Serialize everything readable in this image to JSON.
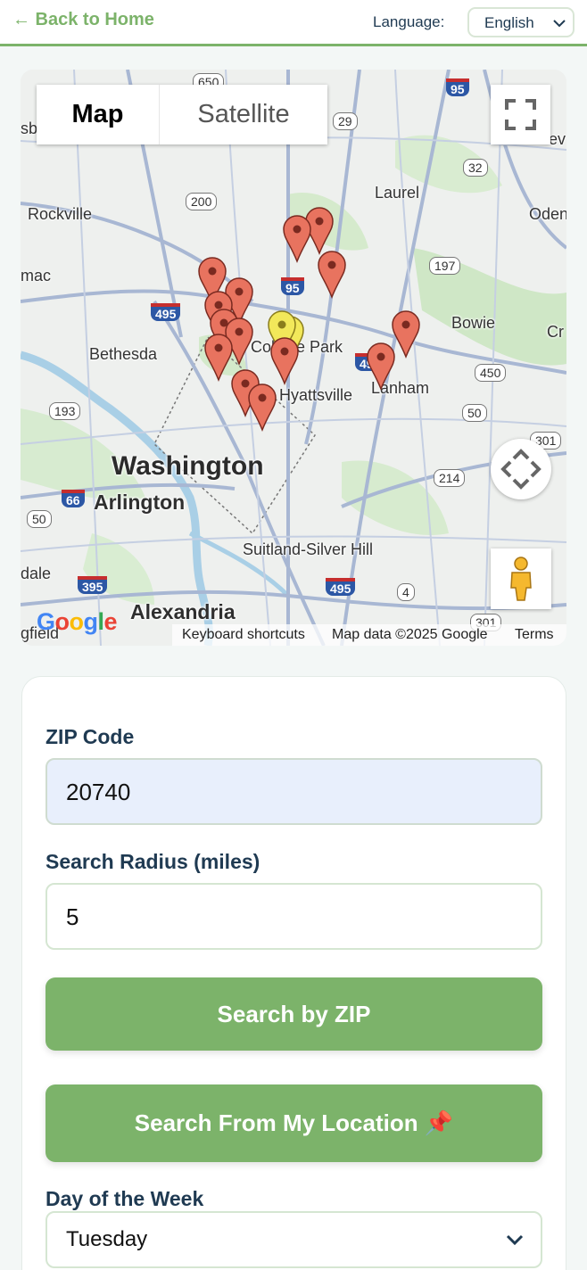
{
  "header": {
    "back_label": "← Back to Home",
    "language_label": "Language:",
    "language_value": "English"
  },
  "map": {
    "type_map": "Map",
    "type_satellite": "Satellite",
    "footer": {
      "keyboard": "Keyboard shortcuts",
      "mapdata": "Map data ©2025 Google",
      "terms": "Terms"
    },
    "logo": "Google",
    "places": [
      "Washington",
      "Arlington",
      "Alexandria",
      "Bethesda",
      "Rockville",
      "Laurel",
      "Bowie",
      "Lanham",
      "College Park",
      "Hyattsville",
      "Suitland-Silver Hill",
      "Oden",
      "Cr",
      "mac",
      "dale",
      "gfield",
      "ev",
      "sb"
    ],
    "route_shields": [
      "650",
      "29",
      "95",
      "32",
      "200",
      "197",
      "495",
      "95",
      "450",
      "193",
      "50",
      "301",
      "214",
      "66",
      "50",
      "395",
      "495",
      "4",
      "301",
      "495"
    ],
    "marker_colors": {
      "red": "#e8735f",
      "yellow": "#f2e85a"
    }
  },
  "form": {
    "zip_label": "ZIP Code",
    "zip_value": "20740",
    "radius_label": "Search Radius (miles)",
    "radius_value": "5",
    "search_zip_button": "Search by ZIP",
    "search_location_button": "Search From My Location 📌",
    "day_label": "Day of the Week",
    "day_value": "Tuesday"
  },
  "colors": {
    "accent": "#7cb36a",
    "heading": "#1f3a52"
  }
}
